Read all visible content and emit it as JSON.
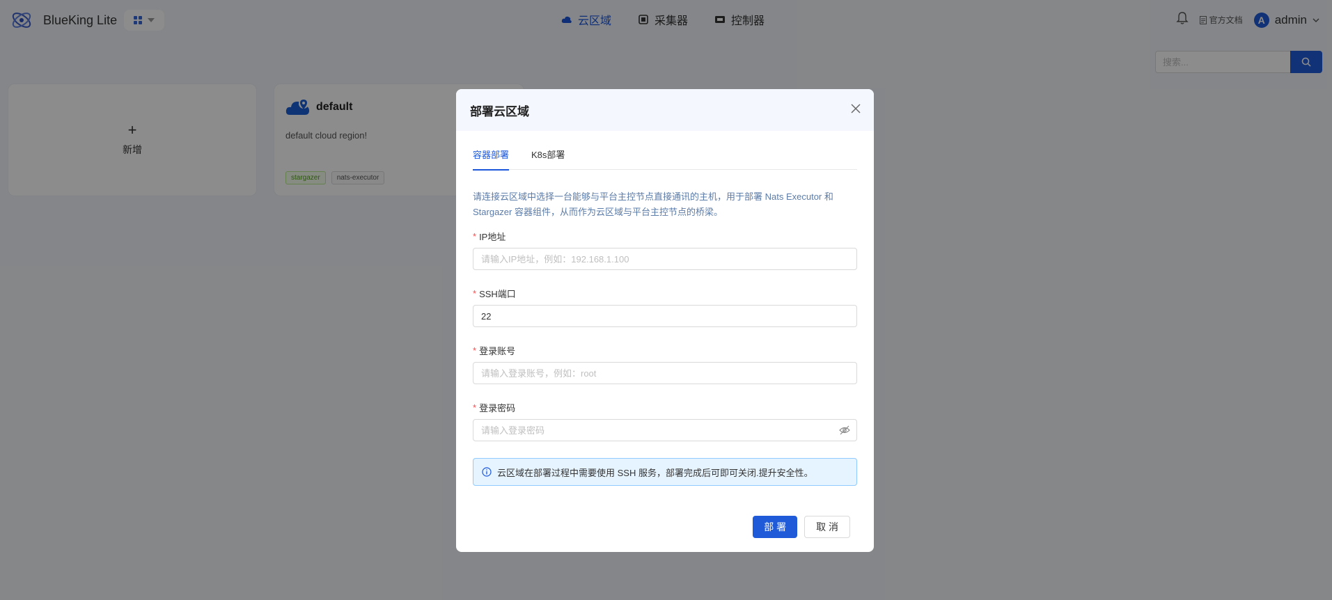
{
  "header": {
    "app_name": "BlueKing Lite",
    "nav": [
      {
        "label": "云区域",
        "icon": "cloud-icon",
        "active": true
      },
      {
        "label": "采集器",
        "icon": "collector-icon",
        "active": false
      },
      {
        "label": "控制器",
        "icon": "controller-icon",
        "active": false
      }
    ],
    "docs_label": "官方文档",
    "user": {
      "avatar_letter": "A",
      "name": "admin"
    }
  },
  "search": {
    "placeholder": "搜索..."
  },
  "cards": {
    "add_label": "新增",
    "default": {
      "title": "default",
      "description": "default cloud region!",
      "tags": [
        "stargazer",
        "nats-executor"
      ]
    }
  },
  "modal": {
    "title": "部署云区域",
    "tabs": [
      "容器部署",
      "K8s部署"
    ],
    "active_tab": "容器部署",
    "intro": "请连接云区域中选择一台能够与平台主控节点直接通讯的主机，用于部署 Nats Executor 和 Stargazer 容器组件，从而作为云区域与平台主控节点的桥梁。",
    "fields": {
      "ip": {
        "label": "IP地址",
        "placeholder": "请输入IP地址，例如：192.168.1.100",
        "value": ""
      },
      "ssh_port": {
        "label": "SSH端口",
        "placeholder": "",
        "value": "22"
      },
      "account": {
        "label": "登录账号",
        "placeholder": "请输入登录账号，例如：root",
        "value": ""
      },
      "password": {
        "label": "登录密码",
        "placeholder": "请输入登录密码",
        "value": ""
      }
    },
    "info": "云区域在部署过程中需要使用 SSH 服务，部署完成后可即可关闭.提升安全性。",
    "buttons": {
      "deploy": "部 署",
      "cancel": "取 消"
    }
  },
  "colors": {
    "primary": "#1f5bd8",
    "active_nav": "#1a56db"
  }
}
